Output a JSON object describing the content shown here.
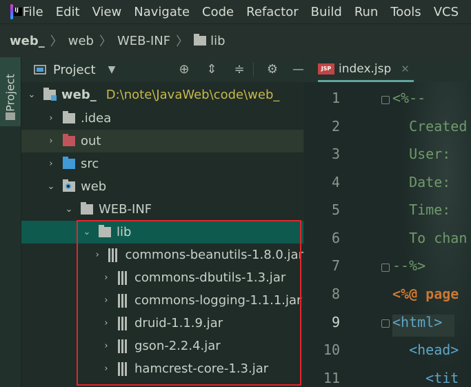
{
  "menubar": {
    "logo_text": "IJ",
    "items": [
      "File",
      "Edit",
      "View",
      "Navigate",
      "Code",
      "Refactor",
      "Build",
      "Run",
      "Tools",
      "VCS"
    ]
  },
  "breadcrumb": {
    "items": [
      "web_",
      "web",
      "WEB-INF",
      "lib"
    ]
  },
  "tool_stripe": {
    "project_label": "Project"
  },
  "project_panel": {
    "title": "Project",
    "icons": [
      "locate-icon",
      "expand-all-icon",
      "collapse-all-icon",
      "gear-icon",
      "minimize-icon"
    ],
    "tree": [
      {
        "label": "web_",
        "path": "D:\\note\\JavaWeb\\code\\web_",
        "icon": "module-folder-icon"
      },
      {
        "label": ".idea",
        "icon": "folder-icon"
      },
      {
        "label": "out",
        "icon": "excluded-folder-icon"
      },
      {
        "label": "src",
        "icon": "source-folder-icon"
      },
      {
        "label": "web",
        "icon": "web-folder-icon"
      },
      {
        "label": "WEB-INF",
        "icon": "folder-icon"
      },
      {
        "label": "lib",
        "icon": "folder-icon"
      },
      {
        "label": "commons-beanutils-1.8.0.jar",
        "icon": "jar-icon"
      },
      {
        "label": "commons-dbutils-1.3.jar",
        "icon": "jar-icon"
      },
      {
        "label": "commons-logging-1.1.1.jar",
        "icon": "jar-icon"
      },
      {
        "label": "druid-1.1.9.jar",
        "icon": "jar-icon"
      },
      {
        "label": "gson-2.2.4.jar",
        "icon": "jar-icon"
      },
      {
        "label": "hamcrest-core-1.3.jar",
        "icon": "jar-icon"
      }
    ]
  },
  "editor": {
    "tab": {
      "label": "index.jsp",
      "icon_text": "JSP"
    },
    "line_numbers": [
      "1",
      "2",
      "3",
      "4",
      "5",
      "6",
      "7",
      "8",
      "9",
      "10",
      "11"
    ],
    "current_line": "9",
    "code": [
      "<%--",
      "  Created",
      "  User: ",
      "  Date: ",
      "  Time: ",
      "  To chan",
      "--%>",
      "<%@ page",
      "<html>",
      "  <head>",
      "    <tit"
    ]
  },
  "colors": {
    "selection": "#0e5a4e",
    "highlight_box": "#e2262b",
    "path_text": "#c9b94a"
  }
}
